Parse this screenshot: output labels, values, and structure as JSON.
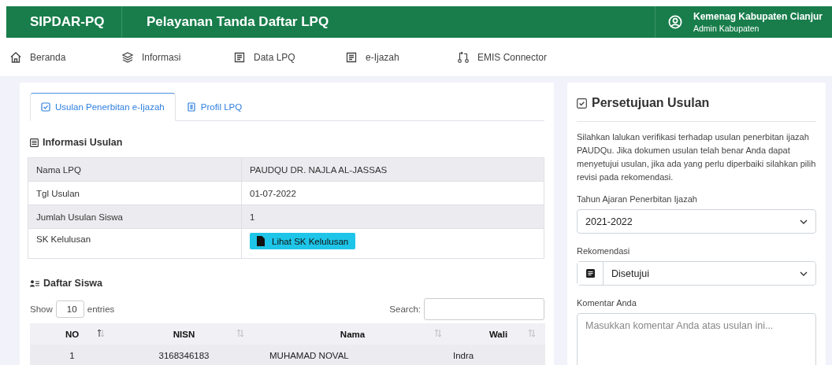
{
  "header": {
    "brand": "SIPDAR-PQ",
    "title": "Pelayanan Tanda Daftar LPQ",
    "user_name": "Kemenag Kabupaten Cianjur",
    "user_role": "Admin Kabupaten"
  },
  "nav": [
    {
      "label": "Beranda",
      "kind": "home"
    },
    {
      "label": "Informasi",
      "kind": "layers"
    },
    {
      "label": "Data LPQ",
      "kind": "document"
    },
    {
      "label": "e-Ijazah",
      "kind": "document"
    },
    {
      "label": "EMIS Connector",
      "kind": "connector"
    }
  ],
  "tabs": [
    {
      "label": "Usulan Penerbitan e-Ijazah",
      "kind": "check",
      "selected": true
    },
    {
      "label": "Profil LPQ",
      "kind": "grid",
      "selected": false
    }
  ],
  "info": {
    "title": "Informasi Usulan",
    "rows": [
      {
        "label": "Nama LPQ",
        "value": "PAUDQU DR. NAJLA AL-JASSAS"
      },
      {
        "label": "Tgl Usulan",
        "value": "01-07-2022"
      },
      {
        "label": "Jumlah Usulan Siswa",
        "value": "1"
      },
      {
        "label": "SK Kelulusan",
        "button": "Lihat SK Kelulusan"
      }
    ]
  },
  "students": {
    "title": "Daftar Siswa",
    "show_label": "Show",
    "page_size": "10",
    "entries_label": "entries",
    "search_label": "Search:",
    "columns": [
      {
        "label": "NO",
        "sorted": true
      },
      {
        "label": "NISN",
        "sorted": false
      },
      {
        "label": "Nama",
        "sorted": false
      },
      {
        "label": "Wali",
        "sorted": false
      }
    ],
    "rows": [
      [
        "1",
        "3168346183",
        "MUHAMAD NOVAL",
        "Indra"
      ]
    ]
  },
  "approval": {
    "title": "Persetujuan Usulan",
    "description": "Silahkan lalukan verifikasi terhadap usulan penerbitan ijazah PAUDQu. Jika dokumen usulan telah benar Anda dapat menyetujui usulan, jika ada yang perlu diperbaiki silahkan pilih revisi pada rekomendasi.",
    "year_label": "Tahun Ajaran Penerbitan Ijazah",
    "year_value": "2021-2022",
    "recommendation_label": "Rekomendasi",
    "recommendation_value": "Disetujui",
    "comment_label": "Komentar Anda",
    "comment_placeholder": "Masukkan komentar Anda atas usulan ini..."
  }
}
